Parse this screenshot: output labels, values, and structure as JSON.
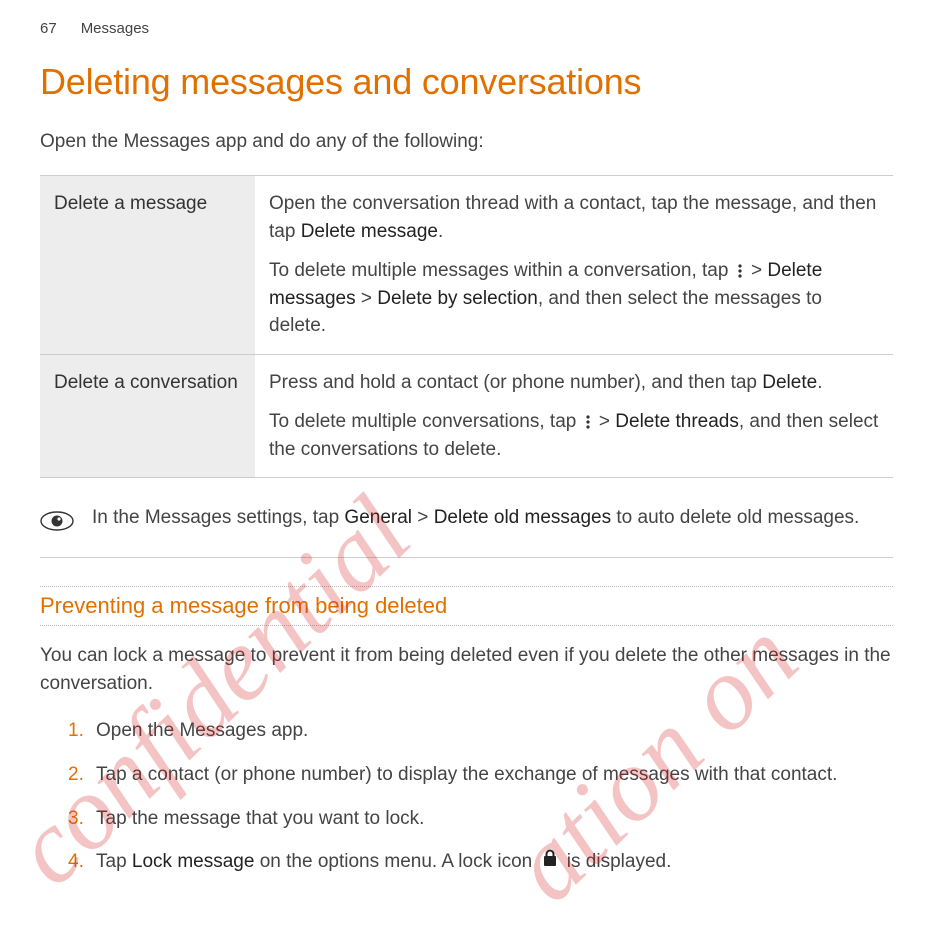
{
  "header": {
    "page_number": "67",
    "section": "Messages"
  },
  "h1": "Deleting messages and conversations",
  "intro": "Open the Messages app and do any of the following:",
  "table": {
    "row1": {
      "label": "Delete a message",
      "p1_pre": "Open the conversation thread with a contact, tap the message, and then tap ",
      "p1_b": "Delete message",
      "p1_post": ".",
      "p2_pre": "To delete multiple messages within a conversation, tap ",
      "p2_b1": "Delete messages",
      "p2_mid": " > ",
      "p2_b2": "Delete by selection",
      "p2_post": ", and then select the messages to delete.",
      "gt": " > "
    },
    "row2": {
      "label": "Delete a conversation",
      "p1_pre": "Press and hold a contact (or phone number), and then tap ",
      "p1_b": "Delete",
      "p1_post": ".",
      "p2_pre": "To delete multiple conversations, tap ",
      "p2_b": "Delete threads",
      "p2_post": ", and then select the conversations to delete.",
      "gt": " > "
    }
  },
  "tip": {
    "pre": "In the Messages settings, tap ",
    "b1": "General",
    "mid": " > ",
    "b2": "Delete old messages",
    "post": " to auto delete old messages."
  },
  "subhead": "Preventing a message from being deleted",
  "para2": "You can lock a message to prevent it from being deleted even if you delete the other messages in the conversation.",
  "steps": {
    "s1": "Open the Messages app.",
    "s2": "Tap a contact (or phone number) to display the exchange of messages with that contact.",
    "s3": "Tap the message that you want to lock.",
    "s4_pre": "Tap ",
    "s4_b": "Lock message",
    "s4_post": " on the options menu. A lock icon ",
    "s4_end": " is displayed."
  },
  "watermarks": {
    "w1": "confidential",
    "w2": "ation on"
  }
}
